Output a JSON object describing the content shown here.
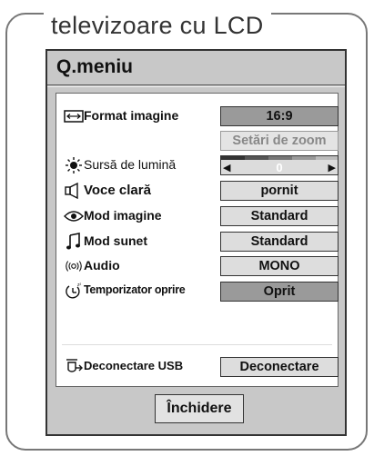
{
  "section_title": "televizoare cu LCD",
  "panel_title": "Q.meniu",
  "rows": [
    {
      "icon": "aspect-ratio-icon",
      "label": "Format imagine",
      "value": "16:9"
    },
    {
      "icon": "",
      "label": "",
      "value": "Setări de zoom"
    },
    {
      "icon": "brightness-icon",
      "label": "Sursă de lumină",
      "value": "0"
    },
    {
      "icon": "speaker-icon",
      "label": "Voce clară",
      "value": "pornit"
    },
    {
      "icon": "eye-icon",
      "label": "Mod imagine",
      "value": "Standard"
    },
    {
      "icon": "music-note-icon",
      "label": "Mod sunet",
      "value": "Standard"
    },
    {
      "icon": "audio-waves-icon",
      "label": "Audio",
      "value": "MONO"
    },
    {
      "icon": "sleep-timer-icon",
      "label": "Temporizator oprire",
      "value": "Oprit"
    },
    {
      "icon": "usb-disconnect-icon",
      "label": "Deconectare USB",
      "value": "Deconectare"
    }
  ],
  "slider": {
    "left_arrow": "◀",
    "right_arrow": "▶",
    "value": "0"
  },
  "close_label": "Închidere",
  "colors": {
    "panel": "#c8c8c8",
    "selected": "#9a9a9a",
    "button": "#dddddd"
  }
}
